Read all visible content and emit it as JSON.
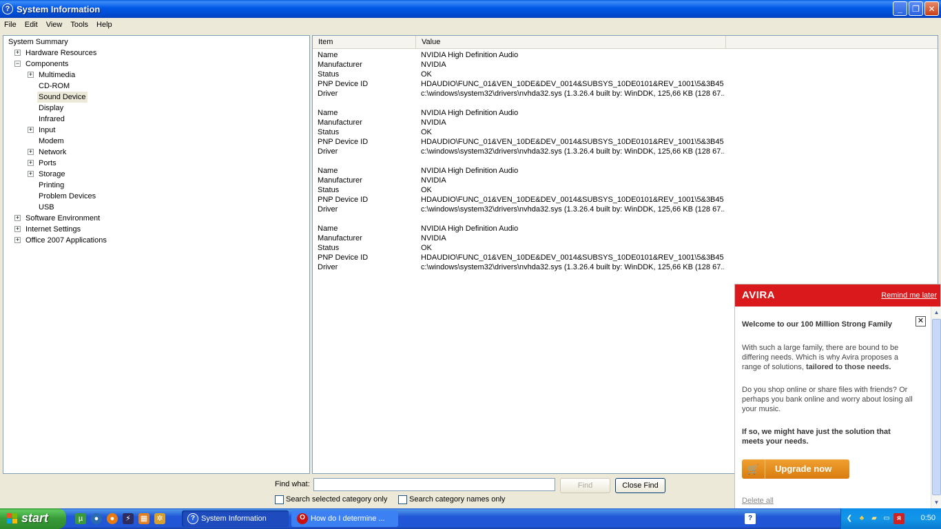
{
  "window": {
    "title": "System Information",
    "icon_glyph": "?",
    "minimize_glyph": "_",
    "restore_glyph": "❐",
    "close_glyph": "✕"
  },
  "menu": [
    "File",
    "Edit",
    "View",
    "Tools",
    "Help"
  ],
  "tree": {
    "items": [
      {
        "label": "System Summary",
        "level": 0,
        "expander": ""
      },
      {
        "label": "Hardware Resources",
        "level": 1,
        "expander": "+"
      },
      {
        "label": "Components",
        "level": 1,
        "expander": "−"
      },
      {
        "label": "Multimedia",
        "level": 2,
        "expander": "+"
      },
      {
        "label": "CD-ROM",
        "level": 2,
        "expander": ""
      },
      {
        "label": "Sound Device",
        "level": 2,
        "expander": "",
        "selected": true
      },
      {
        "label": "Display",
        "level": 2,
        "expander": ""
      },
      {
        "label": "Infrared",
        "level": 2,
        "expander": ""
      },
      {
        "label": "Input",
        "level": 2,
        "expander": "+"
      },
      {
        "label": "Modem",
        "level": 2,
        "expander": ""
      },
      {
        "label": "Network",
        "level": 2,
        "expander": "+"
      },
      {
        "label": "Ports",
        "level": 2,
        "expander": "+"
      },
      {
        "label": "Storage",
        "level": 2,
        "expander": "+"
      },
      {
        "label": "Printing",
        "level": 2,
        "expander": ""
      },
      {
        "label": "Problem Devices",
        "level": 2,
        "expander": ""
      },
      {
        "label": "USB",
        "level": 2,
        "expander": ""
      },
      {
        "label": "Software Environment",
        "level": 1,
        "expander": "+"
      },
      {
        "label": "Internet Settings",
        "level": 1,
        "expander": "+"
      },
      {
        "label": "Office 2007 Applications",
        "level": 1,
        "expander": "+"
      }
    ]
  },
  "list": {
    "columns": [
      "Item",
      "Value"
    ],
    "groups": [
      [
        [
          "Name",
          "NVIDIA High Definition Audio"
        ],
        [
          "Manufacturer",
          "NVIDIA"
        ],
        [
          "Status",
          "OK"
        ],
        [
          "PNP Device ID",
          "HDAUDIO\\FUNC_01&VEN_10DE&DEV_0014&SUBSYS_10DE0101&REV_1001\\5&3B45..."
        ],
        [
          "Driver",
          "c:\\windows\\system32\\drivers\\nvhda32.sys (1.3.26.4 built by: WinDDK, 125,66 KB (128 67..."
        ]
      ],
      [
        [
          "Name",
          "NVIDIA High Definition Audio"
        ],
        [
          "Manufacturer",
          "NVIDIA"
        ],
        [
          "Status",
          "OK"
        ],
        [
          "PNP Device ID",
          "HDAUDIO\\FUNC_01&VEN_10DE&DEV_0014&SUBSYS_10DE0101&REV_1001\\5&3B45..."
        ],
        [
          "Driver",
          "c:\\windows\\system32\\drivers\\nvhda32.sys (1.3.26.4 built by: WinDDK, 125,66 KB (128 67..."
        ]
      ],
      [
        [
          "Name",
          "NVIDIA High Definition Audio"
        ],
        [
          "Manufacturer",
          "NVIDIA"
        ],
        [
          "Status",
          "OK"
        ],
        [
          "PNP Device ID",
          "HDAUDIO\\FUNC_01&VEN_10DE&DEV_0014&SUBSYS_10DE0101&REV_1001\\5&3B45..."
        ],
        [
          "Driver",
          "c:\\windows\\system32\\drivers\\nvhda32.sys (1.3.26.4 built by: WinDDK, 125,66 KB (128 67..."
        ]
      ],
      [
        [
          "Name",
          "NVIDIA High Definition Audio"
        ],
        [
          "Manufacturer",
          "NVIDIA"
        ],
        [
          "Status",
          "OK"
        ],
        [
          "PNP Device ID",
          "HDAUDIO\\FUNC_01&VEN_10DE&DEV_0014&SUBSYS_10DE0101&REV_1001\\5&3B45..."
        ],
        [
          "Driver",
          "c:\\windows\\system32\\drivers\\nvhda32.sys (1.3.26.4 built by: WinDDK, 125,66 KB (128 67..."
        ]
      ]
    ]
  },
  "find": {
    "label": "Find what:",
    "value": "",
    "find_button": "Find",
    "close_find_button": "Close Find",
    "search_selected_label": "Search selected category only",
    "search_names_label": "Search category names only"
  },
  "avira": {
    "logo": "AVIRA",
    "remind": "Remind me later",
    "close_glyph": "✕",
    "title": "Welcome to our 100 Million Strong Family",
    "p1": "With such a large family, there are bound to be differing needs. Which is why Avira proposes a range of solutions, ",
    "p1_bold": "tailored to those needs.",
    "p2": "Do you shop online or share files with friends? Or perhaps you bank online and worry about losing all your music.",
    "p3": "If so, we might have just the solution that meets your needs.",
    "upgrade": "Upgrade now",
    "delete_all": "Delete all",
    "brand_color": "#d9191c",
    "button_color": "#e88d1e"
  },
  "taskbar": {
    "start": "start",
    "tasks": [
      {
        "label": "System Information",
        "icon": "help-icon",
        "active": true
      },
      {
        "label": "How do I determine ...",
        "icon": "opera-icon",
        "active": false
      }
    ],
    "clock": "0:50"
  }
}
